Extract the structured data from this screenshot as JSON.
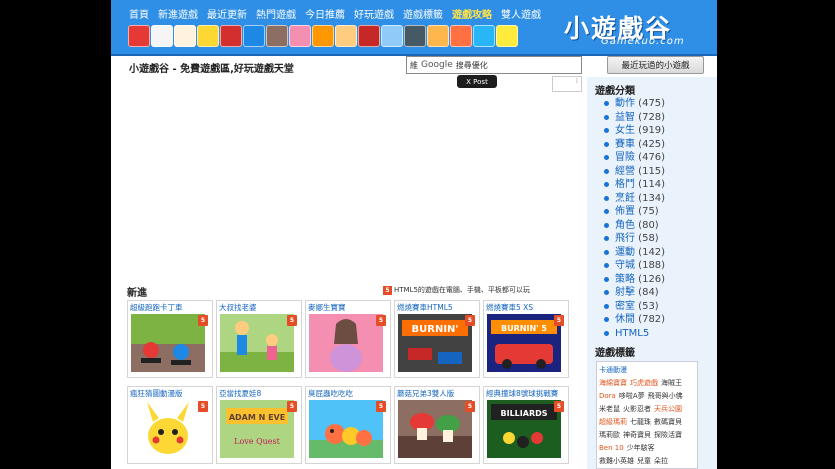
{
  "nav": {
    "items": [
      "首頁",
      "新進遊戲",
      "最近更新",
      "熱門遊戲",
      "今日推薦",
      "好玩遊戲",
      "遊戲標籤",
      "遊戲攻略",
      "雙人遊戲"
    ],
    "active_index": 7
  },
  "logo": {
    "cn": "小遊戲谷",
    "en": "Gamekuo.com"
  },
  "header": {
    "slogan": "小遊戲谷 - 免費遊戲區,好玩遊戲天堂"
  },
  "search": {
    "brand": "Google",
    "placeholder": "搜尋優化",
    "prefix": "維"
  },
  "social": {
    "tweet_label": "X Post"
  },
  "recent_button": "最近玩過的小遊戲",
  "sidebar": {
    "categories_title": "遊戲分類",
    "categories": [
      {
        "name": "動作",
        "count": "(475)"
      },
      {
        "name": "益智",
        "count": "(728)"
      },
      {
        "name": "女生",
        "count": "(919)"
      },
      {
        "name": "賽車",
        "count": "(425)"
      },
      {
        "name": "冒險",
        "count": "(476)"
      },
      {
        "name": "經營",
        "count": "(115)"
      },
      {
        "name": "格鬥",
        "count": "(114)"
      },
      {
        "name": "烹飪",
        "count": "(134)"
      },
      {
        "name": "佈置",
        "count": "(75)"
      },
      {
        "name": "角色",
        "count": "(80)"
      },
      {
        "name": "飛行",
        "count": "(58)"
      },
      {
        "name": "運動",
        "count": "(142)"
      },
      {
        "name": "守城",
        "count": "(188)"
      },
      {
        "name": "策略",
        "count": "(126)"
      },
      {
        "name": "射擊",
        "count": "(84)"
      },
      {
        "name": "密室",
        "count": "(53)"
      },
      {
        "name": "休閒",
        "count": "(782)"
      },
      {
        "name": "HTML5",
        "count": ""
      }
    ],
    "tags_title": "遊戲標籤",
    "tags": [
      {
        "text": "卡通動漫",
        "color": "#1565c0"
      },
      {
        "text": "海綿寶寶",
        "color": "#e2541b"
      },
      {
        "text": "巧虎遊戲",
        "color": "#e2541b"
      },
      {
        "text": "海賊王",
        "color": "#333333"
      },
      {
        "text": "Dora",
        "color": "#e2541b"
      },
      {
        "text": "哆啦A夢",
        "color": "#333333"
      },
      {
        "text": "飛哥與小佛",
        "color": "#333333"
      },
      {
        "text": "米老鼠",
        "color": "#333333"
      },
      {
        "text": "火影忍者",
        "color": "#333333"
      },
      {
        "text": "天兵公園",
        "color": "#e2541b"
      },
      {
        "text": "超級瑪莉",
        "color": "#e2541b"
      },
      {
        "text": "七龍珠",
        "color": "#333333"
      },
      {
        "text": "數碼寶貝",
        "color": "#333333"
      },
      {
        "text": "瑪莉歐",
        "color": "#333333"
      },
      {
        "text": "神奇寶貝",
        "color": "#333333"
      },
      {
        "text": "探險活寶",
        "color": "#333333"
      },
      {
        "text": "Ben 10",
        "color": "#e2541b"
      },
      {
        "text": "少年駭客",
        "color": "#333333"
      },
      {
        "text": "救難小英雄",
        "color": "#333333"
      },
      {
        "text": "兒童",
        "color": "#333333"
      },
      {
        "text": "朵拉",
        "color": "#333333"
      }
    ]
  },
  "new_section": {
    "title": "新進",
    "html5_note": "HTML5的遊戲在電腦、手機、平板都可以玩"
  },
  "games": [
    {
      "title": "超級跑跑卡丁車",
      "thumb": "kart-racing"
    },
    {
      "title": "大叔找老婆",
      "thumb": "cartoon-couple"
    },
    {
      "title": "麥娜生寶寶",
      "thumb": "pregnant-girl"
    },
    {
      "title": "燃燒賽車HTML5",
      "thumb": "burnin-rubber"
    },
    {
      "title": "燃燒賽車5 XS",
      "thumb": "burnin-rubber-5"
    },
    {
      "title": "瘋狂猜圖動漫版",
      "thumb": "pikachu"
    },
    {
      "title": "亞當找夏娃8",
      "thumb": "adam-eve"
    },
    {
      "title": "臭屁蟲吃吃吃",
      "thumb": "caterpillar"
    },
    {
      "title": "蘑菇兄弟3雙人版",
      "thumb": "mushroom-bros"
    },
    {
      "title": "經典撞球8號球挑戰賽",
      "thumb": "billiards"
    }
  ],
  "colors": {
    "header_bg": "#2f8fe6",
    "link": "#1565c0",
    "sidebar_bg": "#eaf2fb",
    "html5_badge": "#e44d26",
    "nav_active": "#ffe14a"
  },
  "header_characters": [
    "angry-bird",
    "cartoon-cat",
    "sheep",
    "spongebob",
    "mario",
    "sonic",
    "dora",
    "girl",
    "naruto",
    "boy",
    "luffy",
    "kid",
    "ninja",
    "boy-2",
    "goku",
    "doraemon",
    "pikachu"
  ]
}
